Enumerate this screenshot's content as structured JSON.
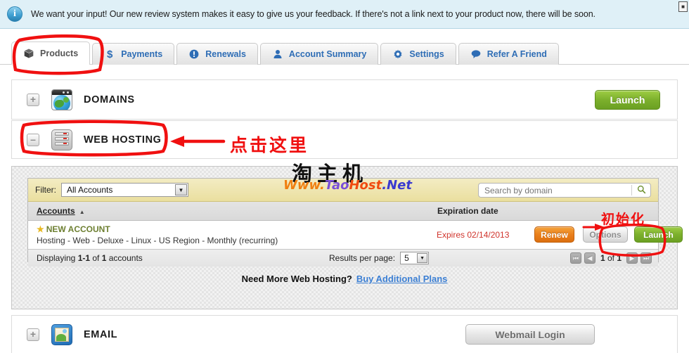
{
  "notice": {
    "icon": "info-icon",
    "text": "We want your input! Our new review system makes it easy to give us your feedback. If there's not a link next to your product now, there will be soon."
  },
  "tabs": [
    {
      "label": "Products",
      "icon": "box-icon",
      "active": true
    },
    {
      "label": "Payments",
      "icon": "dollar-icon",
      "active": false
    },
    {
      "label": "Renewals",
      "icon": "exclaim-icon",
      "active": false
    },
    {
      "label": "Account Summary",
      "icon": "person-icon",
      "active": false
    },
    {
      "label": "Settings",
      "icon": "gear-icon",
      "active": false
    },
    {
      "label": "Refer A Friend",
      "icon": "speech-icon",
      "active": false
    }
  ],
  "products": {
    "domains": {
      "title": "DOMAINS",
      "expander": "+",
      "action_label": "Launch"
    },
    "webhosting": {
      "title": "WEB HOSTING",
      "expander": "–"
    },
    "email": {
      "title": "EMAIL",
      "expander": "+",
      "action_label": "Webmail Login"
    }
  },
  "hosting_panel": {
    "filter_label": "Filter:",
    "filter_value": "All Accounts",
    "search_placeholder": "Search by domain",
    "search_value": "",
    "search_icon": "magnifier-icon",
    "columns": {
      "accounts": "Accounts",
      "sort_caret": "▲",
      "expiration": "Expiration date"
    },
    "rows": [
      {
        "star": "★",
        "name": "NEW ACCOUNT",
        "description": "Hosting - Web - Deluxe - Linux - US Region - Monthly (recurring)",
        "expires": "Expires 02/14/2013",
        "renew_label": "Renew",
        "options_label": "Options",
        "launch_label": "Launch"
      }
    ],
    "footer": {
      "displaying_prefix": "Displaying ",
      "displaying_range": "1-1",
      "displaying_mid": " of ",
      "displaying_total": "1",
      "displaying_suffix": " accounts",
      "results_per_page_label": "Results per page:",
      "results_per_page_value": "5",
      "pager": {
        "first": "⏪",
        "prev": "◀",
        "current": "1",
        "of": " of ",
        "total": "1",
        "next": "▶",
        "last": "⏩"
      }
    },
    "need_more_text": "Need More Web Hosting?",
    "need_more_link": "Buy Additional Plans"
  },
  "watermark": {
    "cn": "淘主机",
    "url_parts": [
      "Www.",
      "Tao",
      "Host",
      ".Net"
    ]
  },
  "annotations": {
    "click_here": "点击这里",
    "initialize": "初始化",
    "color": "#f01010"
  },
  "corner": {
    "icon": "window-icon"
  }
}
